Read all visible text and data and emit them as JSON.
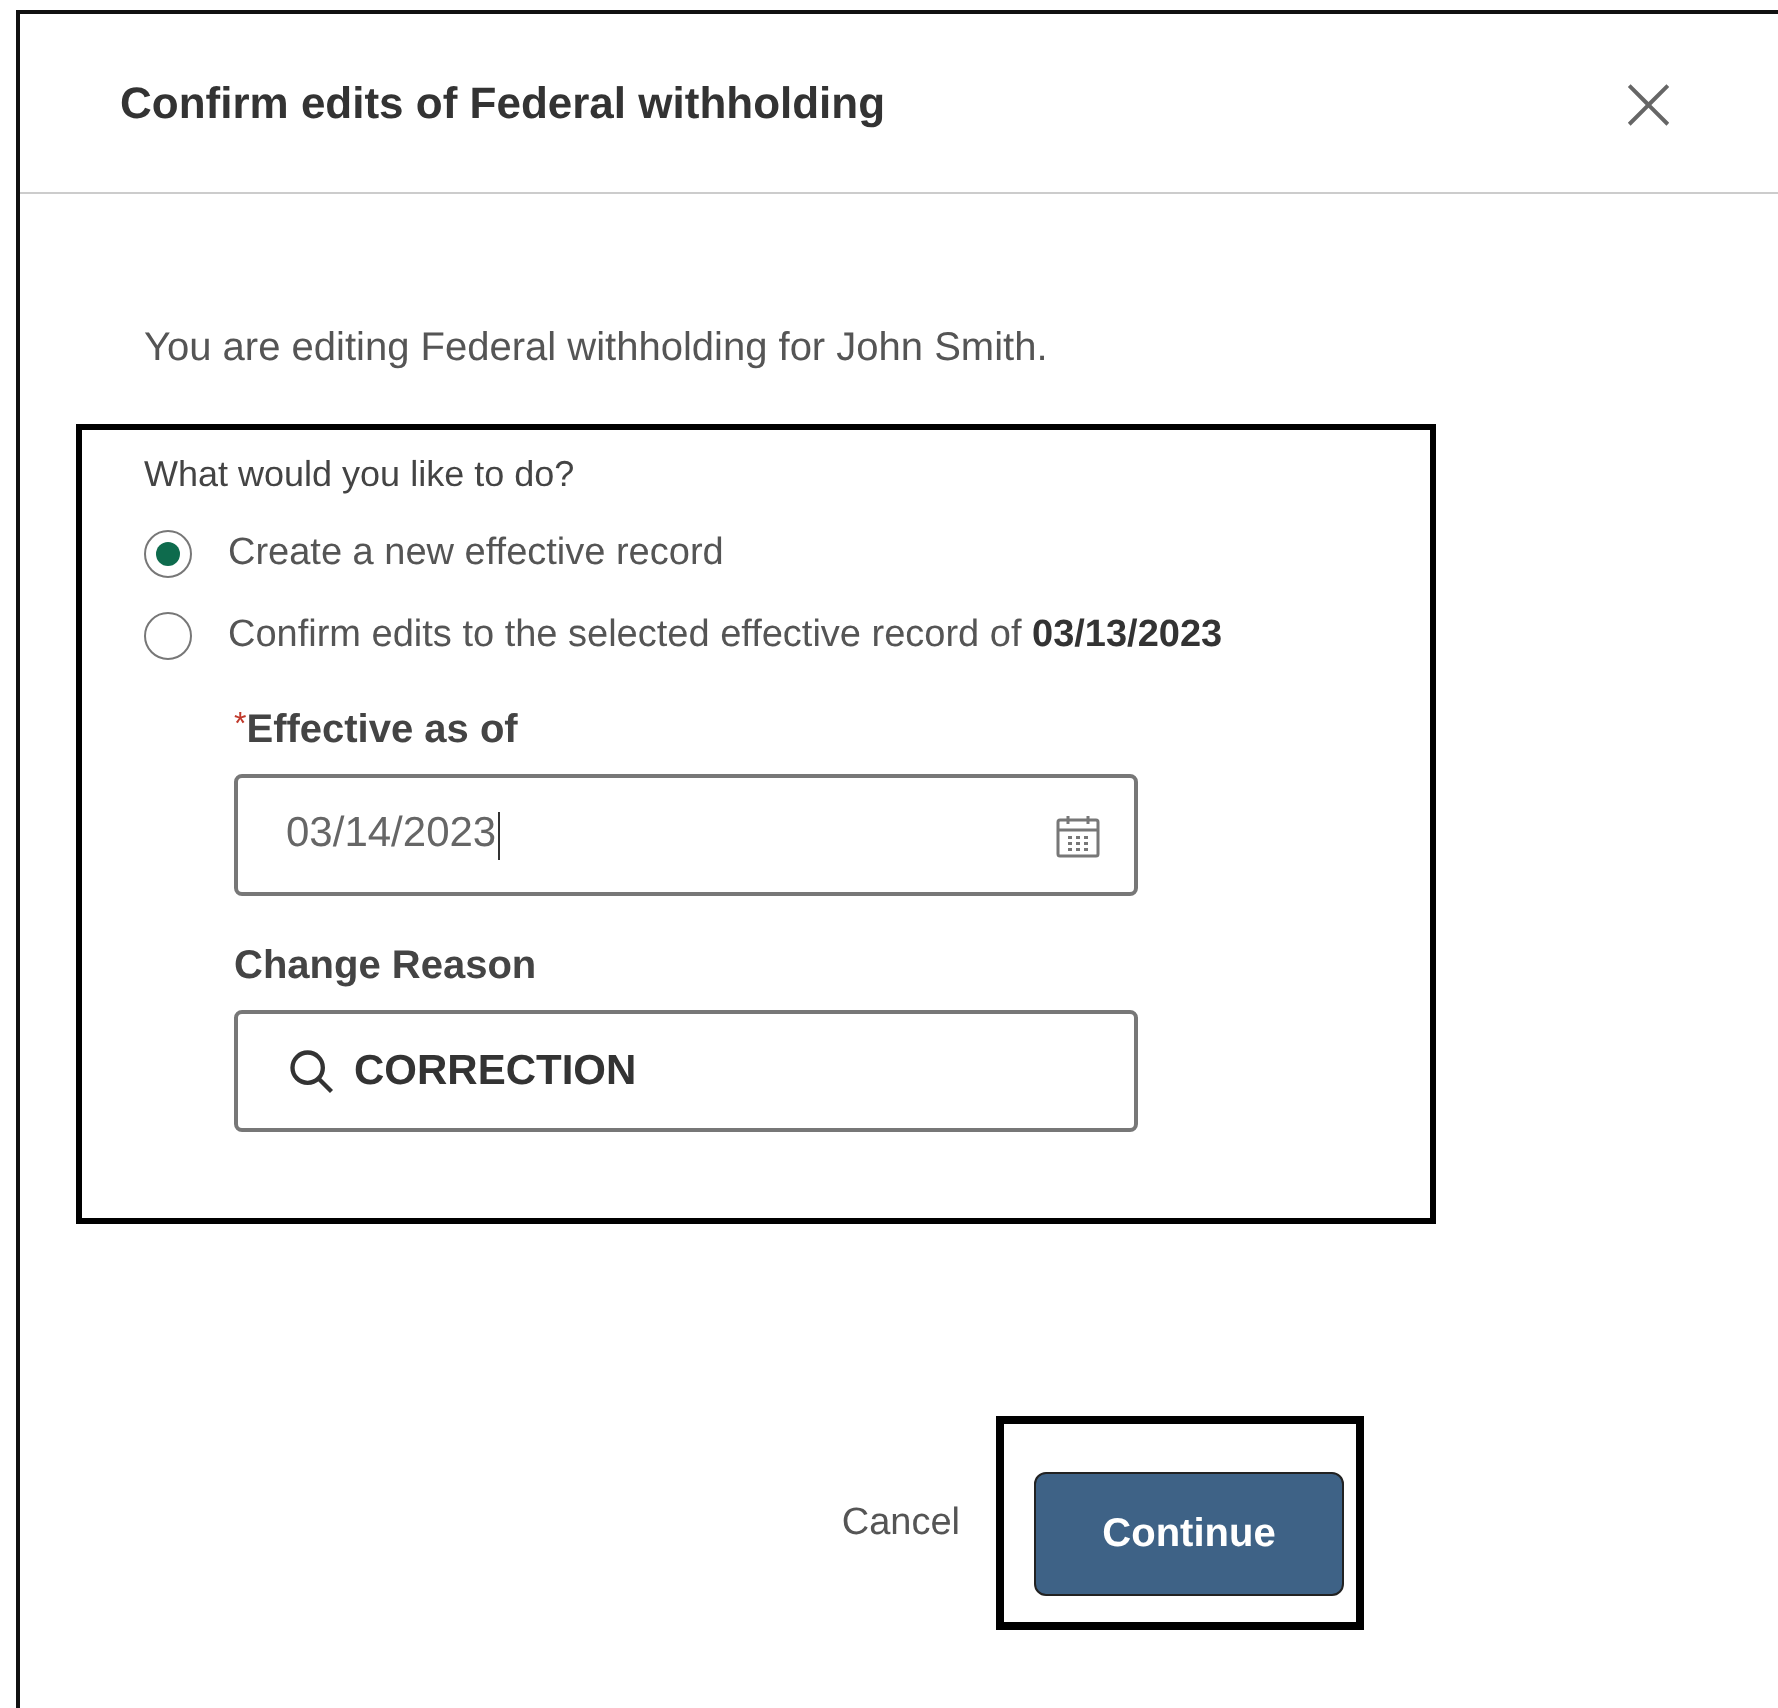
{
  "dialog": {
    "title": "Confirm edits of Federal withholding",
    "close": "×",
    "intro": "You are editing Federal withholding for John Smith.",
    "question": "What would you like to do?",
    "options": [
      {
        "label": "Create a new effective record",
        "selected": true
      },
      {
        "label": "Confirm edits to the selected effective record of **03/13/2023**",
        "selected": false
      }
    ],
    "fields": [
      {
        "kind": "date",
        "required_mark": "*",
        "label": "Effective as of",
        "value": "03/14/2023"
      },
      {
        "kind": "search",
        "label": "Change Reason",
        "value": "CORRECTION"
      }
    ],
    "buttons": {
      "cancel": "Cancel",
      "continue": "Continue"
    }
  }
}
